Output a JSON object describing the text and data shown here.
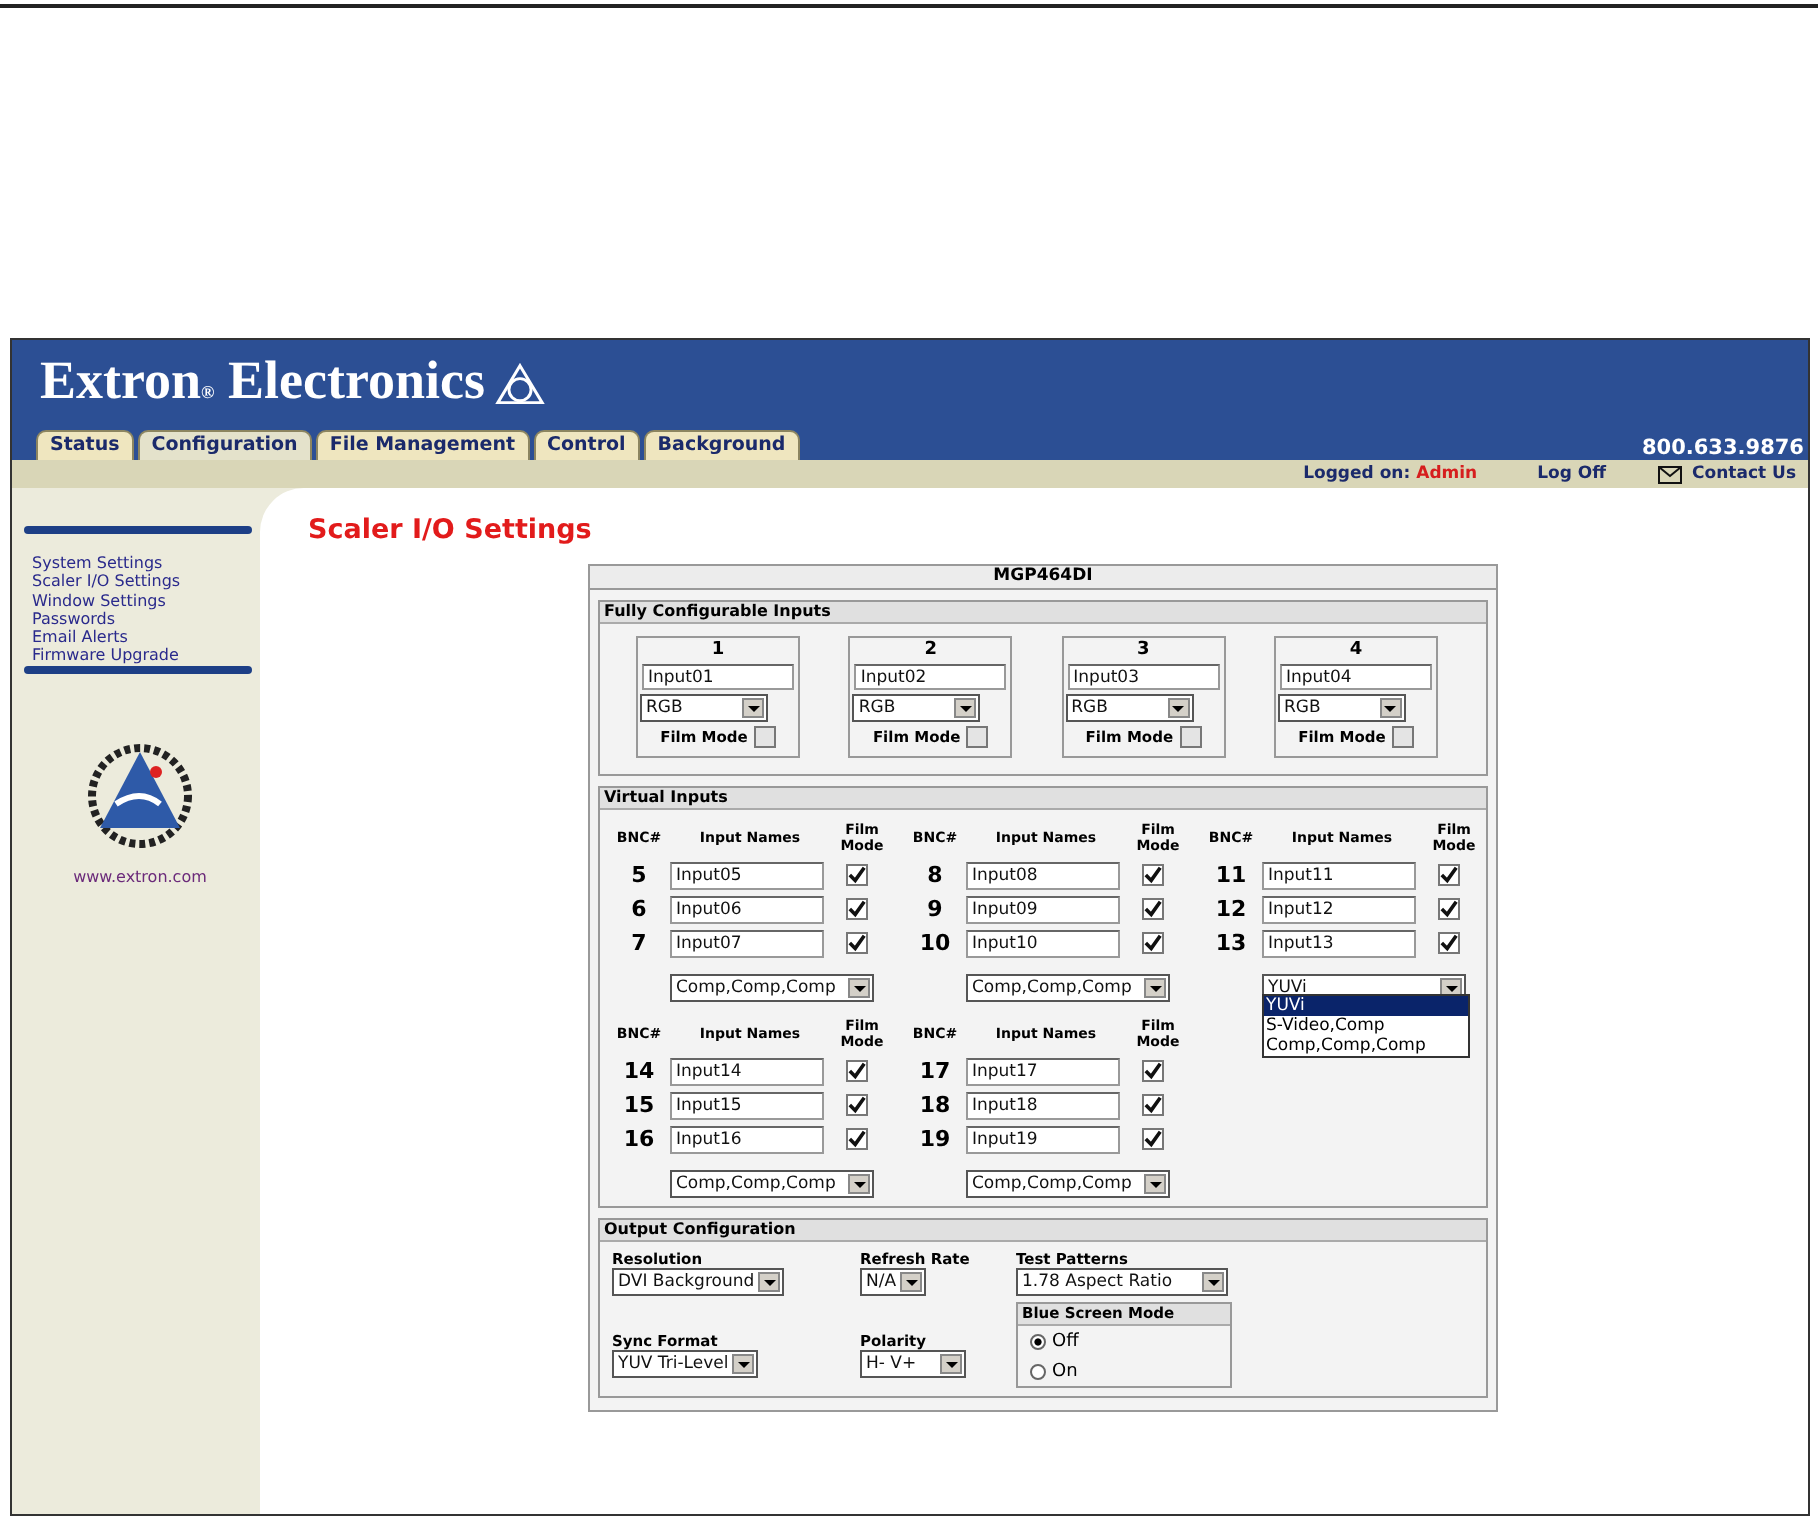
{
  "header": {
    "logo": "Extron",
    "registered": "®",
    "logo_word": "Electronics",
    "phone": "800.633.9876"
  },
  "tabs": [
    {
      "label": "Status",
      "selected": false
    },
    {
      "label": "Configuration",
      "selected": true
    },
    {
      "label": "File Management",
      "selected": false
    },
    {
      "label": "Control",
      "selected": false
    },
    {
      "label": "Background",
      "selected": false
    }
  ],
  "user_bar": {
    "logged_on_label": "Logged on:",
    "user": "Admin",
    "log_off": "Log Off",
    "contact": "Contact Us"
  },
  "sidebar": {
    "items": [
      {
        "label": "System Settings"
      },
      {
        "label": "Scaler I/O Settings"
      },
      {
        "label": "Window Settings"
      },
      {
        "label": "Passwords"
      },
      {
        "label": "Email Alerts"
      },
      {
        "label": "Firmware Upgrade"
      }
    ],
    "website": "www.extron.com"
  },
  "page_title": "Scaler I/O Settings",
  "device": "MGP464DI",
  "fully_configurable": {
    "title": "Fully Configurable Inputs",
    "inputs": [
      {
        "number": "1",
        "name": "Input01",
        "format": "RGB",
        "film_mode_label": "Film Mode",
        "film_mode": false
      },
      {
        "number": "2",
        "name": "Input02",
        "format": "RGB",
        "film_mode_label": "Film Mode",
        "film_mode": false
      },
      {
        "number": "3",
        "name": "Input03",
        "format": "RGB",
        "film_mode_label": "Film Mode",
        "film_mode": false
      },
      {
        "number": "4",
        "name": "Input04",
        "format": "RGB",
        "film_mode_label": "Film Mode",
        "film_mode": false
      }
    ]
  },
  "virtual_inputs": {
    "title": "Virtual Inputs",
    "groups": [
      {
        "bnc_header": "BNC#",
        "names_header": "Input Names",
        "film_header": "Film Mode",
        "rows": [
          {
            "bnc": "5",
            "name": "Input05",
            "film_mode": true
          },
          {
            "bnc": "6",
            "name": "Input06",
            "film_mode": true
          },
          {
            "bnc": "7",
            "name": "Input07",
            "film_mode": true
          }
        ],
        "format": "Comp,Comp,Comp",
        "expanded": false
      },
      {
        "bnc_header": "BNC#",
        "names_header": "Input Names",
        "film_header": "Film Mode",
        "rows": [
          {
            "bnc": "8",
            "name": "Input08",
            "film_mode": true
          },
          {
            "bnc": "9",
            "name": "Input09",
            "film_mode": true
          },
          {
            "bnc": "10",
            "name": "Input10",
            "film_mode": true
          }
        ],
        "format": "Comp,Comp,Comp",
        "expanded": false
      },
      {
        "bnc_header": "BNC#",
        "names_header": "Input Names",
        "film_header": "Film Mode",
        "rows": [
          {
            "bnc": "11",
            "name": "Input11",
            "film_mode": true
          },
          {
            "bnc": "12",
            "name": "Input12",
            "film_mode": true
          },
          {
            "bnc": "13",
            "name": "Input13",
            "film_mode": true
          }
        ],
        "format": "YUVi",
        "expanded": true,
        "options": [
          {
            "label": "YUVi",
            "selected": true
          },
          {
            "label": "S-Video,Comp",
            "selected": false
          },
          {
            "label": "Comp,Comp,Comp",
            "selected": false
          }
        ]
      },
      {
        "bnc_header": "BNC#",
        "names_header": "Input Names",
        "film_header": "Film Mode",
        "rows": [
          {
            "bnc": "14",
            "name": "Input14",
            "film_mode": true
          },
          {
            "bnc": "15",
            "name": "Input15",
            "film_mode": true
          },
          {
            "bnc": "16",
            "name": "Input16",
            "film_mode": true
          }
        ],
        "format": "Comp,Comp,Comp",
        "expanded": false
      },
      {
        "bnc_header": "BNC#",
        "names_header": "Input Names",
        "film_header": "Film Mode",
        "rows": [
          {
            "bnc": "17",
            "name": "Input17",
            "film_mode": true
          },
          {
            "bnc": "18",
            "name": "Input18",
            "film_mode": true
          },
          {
            "bnc": "19",
            "name": "Input19",
            "film_mode": true
          }
        ],
        "format": "Comp,Comp,Comp",
        "expanded": false
      }
    ]
  },
  "output_configuration": {
    "title": "Output Configuration",
    "resolution": {
      "label": "Resolution",
      "value": "DVI Background"
    },
    "refresh_rate": {
      "label": "Refresh Rate",
      "value": "N/A"
    },
    "test_patterns": {
      "label": "Test Patterns",
      "value": "1.78 Aspect Ratio"
    },
    "sync_format": {
      "label": "Sync Format",
      "value": "YUV Tri-Level"
    },
    "polarity": {
      "label": "Polarity",
      "value": "H- V+"
    },
    "blue_screen_mode": {
      "title": "Blue Screen Mode",
      "options": [
        {
          "label": "Off",
          "selected": true
        },
        {
          "label": "On",
          "selected": false
        }
      ]
    }
  }
}
